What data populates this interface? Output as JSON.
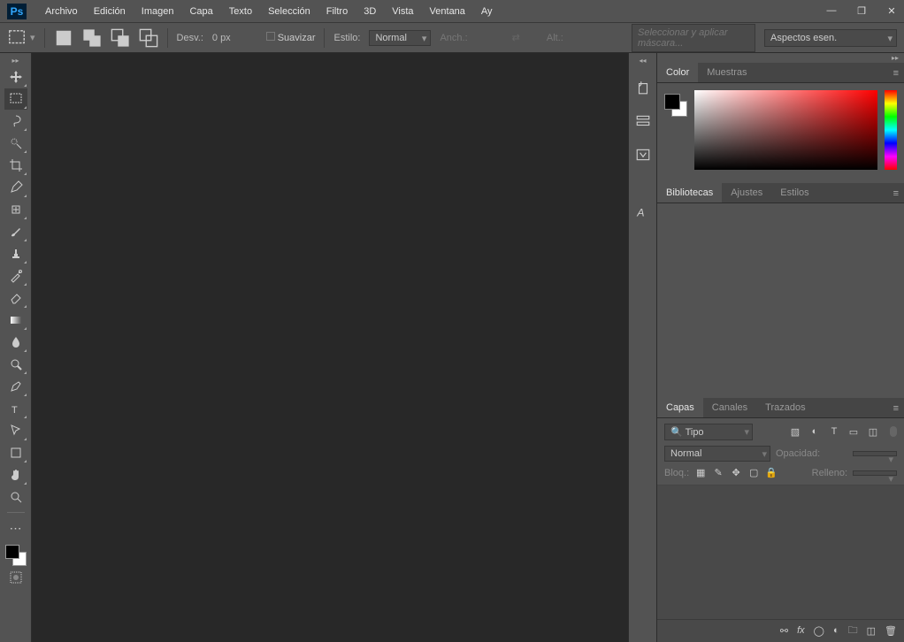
{
  "app": {
    "logo": "Ps"
  },
  "menu": [
    "Archivo",
    "Edición",
    "Imagen",
    "Capa",
    "Texto",
    "Selección",
    "Filtro",
    "3D",
    "Vista",
    "Ventana",
    "Ay"
  ],
  "options": {
    "desv_label": "Desv.:",
    "desv_value": "0 px",
    "suavizar": "Suavizar",
    "estilo_label": "Estilo:",
    "estilo_value": "Normal",
    "anch_label": "Anch.:",
    "alt_label": "Alt.:",
    "mask_btn": "Seleccionar y aplicar máscara...",
    "workspace": "Aspectos esen."
  },
  "panels": {
    "color_tabs": [
      "Color",
      "Muestras"
    ],
    "lib_tabs": [
      "Bibliotecas",
      "Ajustes",
      "Estilos"
    ],
    "layer_tabs": [
      "Capas",
      "Canales",
      "Trazados"
    ]
  },
  "layers": {
    "filter_label": "Tipo",
    "blend": "Normal",
    "opacity_label": "Opacidad:",
    "lock_label": "Bloq.:",
    "fill_label": "Relleno:"
  }
}
